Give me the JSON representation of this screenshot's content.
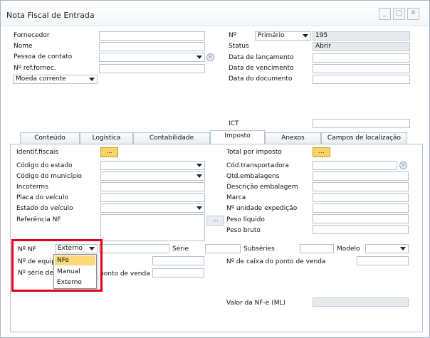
{
  "window": {
    "title": "Nota Fiscal de Entrada"
  },
  "header_left": {
    "fornecedor": "Fornecedor",
    "nome": "Nome",
    "pessoa_contato": "Pessoa de contato",
    "ref_fornec": "Nº ref.fornec.",
    "moeda": "Moeda corrente"
  },
  "header_right": {
    "no_label": "Nº",
    "series_select": "Primário",
    "doc_number": "195",
    "status_label": "Status",
    "status_value": "Abrir",
    "data_lancamento": "Data de lançamento",
    "data_vencimento": "Data de vencimento",
    "data_documento": "Data do documento",
    "ict": "ICT"
  },
  "tabs": [
    "Conteúdo",
    "Logística",
    "Contabilidade",
    "Imposto",
    "Anexos",
    "Campos de localização"
  ],
  "active_tab": "Imposto",
  "imposto_left": {
    "identif_fiscais": "Identif.fiscais",
    "codigo_estado": "Código do estado",
    "codigo_municipio": "Código do município",
    "incoterms": "Incoterms",
    "placa_veiculo": "Placa do veículo",
    "estado_veiculo": "Estado do veículo",
    "referencia_nf": "Referência NF",
    "browse_button": "..."
  },
  "imposto_right": {
    "total_imposto": "Total por imposto",
    "cod_transportadora": "Cód.transportadora",
    "qtd_embalagens": "Qtd.embalagens",
    "descricao_embalagem": "Descrição embalagem",
    "marca": "Marca",
    "unidade_expedicao": "Nº unidade expedição",
    "peso_liquido": "Peso líquido",
    "peso_bruto": "Peso bruto"
  },
  "nf_row": {
    "no_nf": "Nº NF",
    "tipo_selected": "Externo",
    "serie": "Série",
    "subseries": "Subséries",
    "modelo": "Modelo"
  },
  "pdv": {
    "no_equip_partial": "Nº de equip",
    "no_serie_partial": "Nº série de",
    "ponto_venda_partial": "ponto de venda",
    "caixa_pdv": "Nº de caixa do ponto de venda"
  },
  "tipo_dropdown": {
    "options": [
      "NFe",
      "Manual",
      "Externo"
    ],
    "highlighted": "NFe"
  },
  "valor_nfe": "Valor da NF-e (ML)",
  "ellipsis": "...",
  "icons": {
    "info": "info-circle-icon",
    "minimize": "minimize-icon",
    "maximize": "maximize-icon",
    "close": "close-icon"
  },
  "colors": {
    "highlight_red": "#e3001b",
    "yellow_button": "#f8d36a",
    "dropdown_highlight": "#fbd97a"
  }
}
